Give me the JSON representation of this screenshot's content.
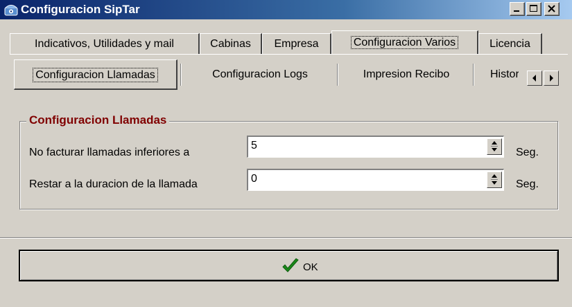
{
  "window": {
    "title": "Configuracion SipTar"
  },
  "icons": {
    "app": "telephone-icon",
    "minimize": "minimize-icon",
    "maximize": "maximize-icon",
    "close": "close-icon",
    "scroll_left": "arrow-left-icon",
    "scroll_right": "arrow-right-icon",
    "spin": "spinner-icon",
    "ok": "checkmark-icon"
  },
  "main_tabs": [
    {
      "label": "Indicativos, Utilidades y mail"
    },
    {
      "label": "Cabinas"
    },
    {
      "label": "Empresa"
    },
    {
      "label": "Configuracion Varios"
    },
    {
      "label": "Licencia"
    }
  ],
  "sub_tabs": [
    {
      "label": "Configuracion Llamadas"
    },
    {
      "label": "Configuracion Logs"
    },
    {
      "label": "Impresion Recibo"
    },
    {
      "label": "Histori"
    }
  ],
  "group": {
    "title": "Configuracion Llamadas",
    "rows": [
      {
        "label": "No facturar llamadas inferiores a",
        "value": "5",
        "unit": "Seg."
      },
      {
        "label": "Restar a la duracion de la llamada",
        "value": "0",
        "unit": "Seg."
      }
    ]
  },
  "ok_button": {
    "label": "OK"
  },
  "colors": {
    "titlebar_start": "#0a246a",
    "window_bg": "#d4d0c8",
    "group_title": "#800000",
    "check_green": "#1a8a1a"
  }
}
